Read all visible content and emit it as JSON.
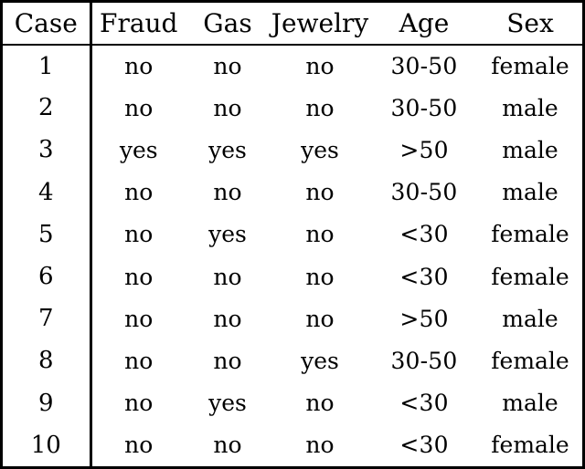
{
  "table": {
    "columns": [
      {
        "key": "case",
        "label": "Case"
      },
      {
        "key": "fraud",
        "label": "Fraud"
      },
      {
        "key": "gas",
        "label": "Gas"
      },
      {
        "key": "jewelry",
        "label": "Jewelry"
      },
      {
        "key": "age",
        "label": "Age"
      },
      {
        "key": "sex",
        "label": "Sex"
      }
    ],
    "rows": [
      {
        "case": "1",
        "fraud": "no",
        "gas": "no",
        "jewelry": "no",
        "age": "30-50",
        "sex": "female"
      },
      {
        "case": "2",
        "fraud": "no",
        "gas": "no",
        "jewelry": "no",
        "age": "30-50",
        "sex": "male"
      },
      {
        "case": "3",
        "fraud": "yes",
        "gas": "yes",
        "jewelry": "yes",
        "age": ">50",
        "sex": "male"
      },
      {
        "case": "4",
        "fraud": "no",
        "gas": "no",
        "jewelry": "no",
        "age": "30-50",
        "sex": "male"
      },
      {
        "case": "5",
        "fraud": "no",
        "gas": "yes",
        "jewelry": "no",
        "age": "<30",
        "sex": "female"
      },
      {
        "case": "6",
        "fraud": "no",
        "gas": "no",
        "jewelry": "no",
        "age": "<30",
        "sex": "female"
      },
      {
        "case": "7",
        "fraud": "no",
        "gas": "no",
        "jewelry": "no",
        "age": ">50",
        "sex": "male"
      },
      {
        "case": "8",
        "fraud": "no",
        "gas": "no",
        "jewelry": "yes",
        "age": "30-50",
        "sex": "female"
      },
      {
        "case": "9",
        "fraud": "no",
        "gas": "yes",
        "jewelry": "no",
        "age": "<30",
        "sex": "male"
      },
      {
        "case": "10",
        "fraud": "no",
        "gas": "no",
        "jewelry": "no",
        "age": "<30",
        "sex": "female"
      }
    ]
  },
  "colors": {
    "text": "#000000",
    "background": "#ffffff",
    "rule": "#000000"
  }
}
